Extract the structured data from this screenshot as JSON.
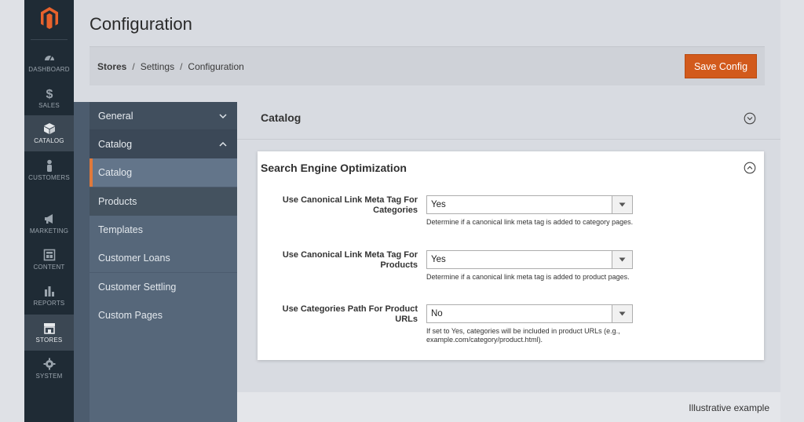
{
  "admin_nav": {
    "items": [
      {
        "label": "DASHBOARD",
        "icon": "gauge-icon"
      },
      {
        "label": "SALES",
        "icon": "dollar-icon"
      },
      {
        "label": "CATALOG",
        "icon": "cube-icon"
      },
      {
        "label": "CUSTOMERS",
        "icon": "person-icon"
      },
      {
        "label": "MARKETING",
        "icon": "megaphone-icon"
      },
      {
        "label": "CONTENT",
        "icon": "layout-icon"
      },
      {
        "label": "REPORTS",
        "icon": "bar-chart-icon"
      },
      {
        "label": "STORES",
        "icon": "storefront-icon"
      },
      {
        "label": "SYSTEM",
        "icon": "gear-icon"
      }
    ],
    "active": "CATALOG"
  },
  "page": {
    "title": "Configuration"
  },
  "toolbar": {
    "breadcrumb": [
      "Stores",
      "Settings",
      "Configuration"
    ],
    "save_label": "Save Config",
    "save_color": "#d25a1c"
  },
  "config_nav": {
    "items": [
      {
        "label": "General",
        "type": "section",
        "state": "collapsed"
      },
      {
        "label": "Catalog",
        "type": "section",
        "state": "expanded"
      },
      {
        "label": "Catalog",
        "type": "sub",
        "current": true
      },
      {
        "label": "Products",
        "type": "sub"
      },
      {
        "label": "Templates",
        "type": "sub"
      },
      {
        "label": "Customer Loans",
        "type": "sub"
      },
      {
        "label": "Customer Settling",
        "type": "sub"
      },
      {
        "label": "Custom Pages",
        "type": "sub"
      }
    ],
    "accent_color": "#e0793b"
  },
  "content": {
    "group_title": "Catalog",
    "section_title": "Search Engine Optimization",
    "fields": [
      {
        "label": "Use Canonical Link Meta Tag For Categories",
        "value": "Yes",
        "note": "Determine if a canonical link meta tag is added to category pages."
      },
      {
        "label": "Use Canonical Link Meta Tag For Products",
        "value": "Yes",
        "note": "Determine if a canonical link meta tag is added to product pages."
      },
      {
        "label": "Use Categories Path For Product URLs",
        "value": "No",
        "note": "If set to Yes, categories will be included in product URLs (e.g., example.com/category/product.html)."
      }
    ]
  },
  "footer": {
    "caption": "Illustrative example"
  }
}
